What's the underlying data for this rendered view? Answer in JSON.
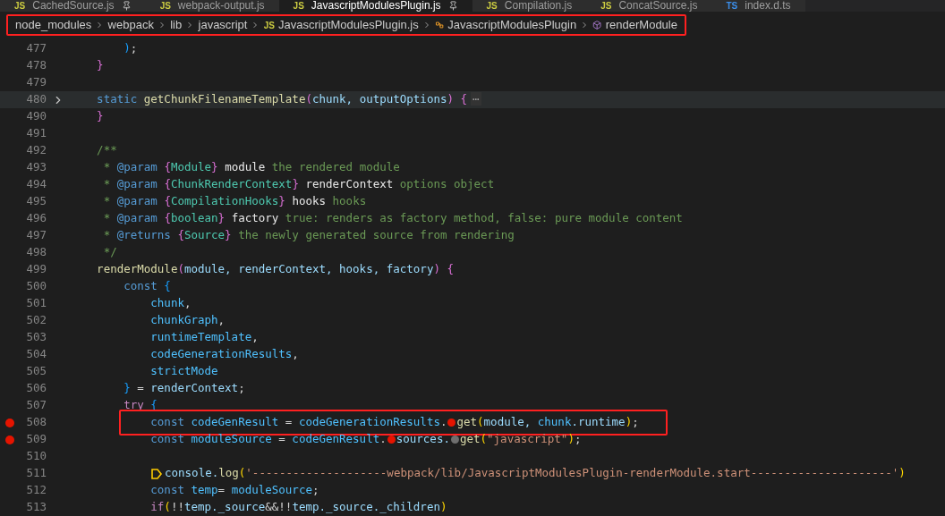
{
  "tabs": [
    {
      "icon": "JS",
      "label": "CachedSource.js",
      "pinned": true,
      "selected": false
    },
    {
      "icon": "JS",
      "label": "webpack-output.js",
      "pinned": false,
      "selected": false
    },
    {
      "icon": "JS",
      "label": "JavascriptModulesPlugin.js",
      "pinned": true,
      "selected": true
    },
    {
      "icon": "JS",
      "label": "Compilation.js",
      "pinned": false,
      "selected": false
    },
    {
      "icon": "JS",
      "label": "ConcatSource.js",
      "pinned": false,
      "selected": false
    },
    {
      "icon": "TS",
      "label": "index.d.ts",
      "pinned": false,
      "selected": false
    }
  ],
  "breadcrumb": {
    "annotated": true,
    "items": [
      {
        "kind": "folder",
        "label": "node_modules"
      },
      {
        "kind": "folder",
        "label": "webpack"
      },
      {
        "kind": "folder",
        "label": "lib"
      },
      {
        "kind": "folder",
        "label": "javascript"
      },
      {
        "kind": "file",
        "icon": "JS",
        "label": "JavascriptModulesPlugin.js"
      },
      {
        "kind": "class",
        "label": "JavascriptModulesPlugin"
      },
      {
        "kind": "method",
        "label": "renderModule"
      }
    ]
  },
  "lines": [
    {
      "number": "477",
      "breakpoint": false,
      "folded": false,
      "current": false,
      "annotated": false,
      "tokens": [
        {
          "kind": "bracket3",
          "text": "        )"
        },
        {
          "kind": "punct",
          "text": ";"
        }
      ]
    },
    {
      "number": "478",
      "breakpoint": false,
      "folded": false,
      "current": false,
      "annotated": false,
      "tokens": [
        {
          "kind": "bracket2",
          "text": "    }"
        }
      ]
    },
    {
      "number": "479",
      "breakpoint": false,
      "folded": false,
      "current": false,
      "annotated": false
    },
    {
      "number": "480",
      "breakpoint": false,
      "folded": true,
      "current": true,
      "annotated": false,
      "tokens": [
        {
          "kind": "keyword",
          "text": "    static "
        },
        {
          "kind": "function",
          "text": "getChunkFilenameTemplate"
        },
        {
          "kind": "bracket2",
          "text": "("
        },
        {
          "kind": "param",
          "text": "chunk, outputOptions"
        },
        {
          "kind": "bracket2",
          "text": ") {"
        },
        {
          "kind": "ellipsis",
          "text": "⋯"
        }
      ]
    },
    {
      "number": "490",
      "breakpoint": false,
      "folded": false,
      "current": false,
      "annotated": false,
      "tokens": [
        {
          "kind": "bracket2",
          "text": "    }"
        }
      ]
    },
    {
      "number": "491",
      "breakpoint": false,
      "folded": false,
      "current": false,
      "annotated": false
    },
    {
      "number": "492",
      "breakpoint": false,
      "folded": false,
      "current": false,
      "annotated": false,
      "tokens": [
        {
          "kind": "comment",
          "text": "    /**"
        }
      ]
    },
    {
      "number": "493",
      "breakpoint": false,
      "folded": false,
      "current": false,
      "annotated": false,
      "tokens": [
        {
          "kind": "comment",
          "text": "     * "
        },
        {
          "kind": "tag",
          "text": "@param "
        },
        {
          "kind": "bracket2",
          "text": "{"
        },
        {
          "kind": "type",
          "text": "Module"
        },
        {
          "kind": "bracket2",
          "text": "} "
        },
        {
          "kind": "docname",
          "text": "module"
        },
        {
          "kind": "comment",
          "text": " the rendered module"
        }
      ]
    },
    {
      "number": "494",
      "breakpoint": false,
      "folded": false,
      "current": false,
      "annotated": false,
      "tokens": [
        {
          "kind": "comment",
          "text": "     * "
        },
        {
          "kind": "tag",
          "text": "@param "
        },
        {
          "kind": "bracket2",
          "text": "{"
        },
        {
          "kind": "type",
          "text": "ChunkRenderContext"
        },
        {
          "kind": "bracket2",
          "text": "} "
        },
        {
          "kind": "docname",
          "text": "renderContext"
        },
        {
          "kind": "comment",
          "text": " options object"
        }
      ]
    },
    {
      "number": "495",
      "breakpoint": false,
      "folded": false,
      "current": false,
      "annotated": false,
      "tokens": [
        {
          "kind": "comment",
          "text": "     * "
        },
        {
          "kind": "tag",
          "text": "@param "
        },
        {
          "kind": "bracket2",
          "text": "{"
        },
        {
          "kind": "type",
          "text": "CompilationHooks"
        },
        {
          "kind": "bracket2",
          "text": "} "
        },
        {
          "kind": "docname",
          "text": "hooks"
        },
        {
          "kind": "comment",
          "text": " hooks"
        }
      ]
    },
    {
      "number": "496",
      "breakpoint": false,
      "folded": false,
      "current": false,
      "annotated": false,
      "tokens": [
        {
          "kind": "comment",
          "text": "     * "
        },
        {
          "kind": "tag",
          "text": "@param "
        },
        {
          "kind": "bracket2",
          "text": "{"
        },
        {
          "kind": "type",
          "text": "boolean"
        },
        {
          "kind": "bracket2",
          "text": "} "
        },
        {
          "kind": "docname",
          "text": "factory"
        },
        {
          "kind": "comment",
          "text": " true: renders as factory method, false: pure module content"
        }
      ]
    },
    {
      "number": "497",
      "breakpoint": false,
      "folded": false,
      "current": false,
      "annotated": false,
      "tokens": [
        {
          "kind": "comment",
          "text": "     * "
        },
        {
          "kind": "tag",
          "text": "@returns "
        },
        {
          "kind": "bracket2",
          "text": "{"
        },
        {
          "kind": "type",
          "text": "Source"
        },
        {
          "kind": "bracket2",
          "text": "}"
        },
        {
          "kind": "comment",
          "text": " the newly generated source from rendering"
        }
      ]
    },
    {
      "number": "498",
      "breakpoint": false,
      "folded": false,
      "current": false,
      "annotated": false,
      "tokens": [
        {
          "kind": "comment",
          "text": "     */"
        }
      ]
    },
    {
      "number": "499",
      "breakpoint": false,
      "folded": false,
      "current": false,
      "annotated": false,
      "tokens": [
        {
          "kind": "function",
          "text": "    renderModule"
        },
        {
          "kind": "bracket2",
          "text": "("
        },
        {
          "kind": "param",
          "text": "module, renderContext, hooks, factory"
        },
        {
          "kind": "bracket2",
          "text": ") {"
        }
      ]
    },
    {
      "number": "500",
      "breakpoint": false,
      "folded": false,
      "current": false,
      "annotated": false,
      "tokens": [
        {
          "kind": "keyword",
          "text": "        const "
        },
        {
          "kind": "bracket3",
          "text": "{"
        }
      ]
    },
    {
      "number": "501",
      "breakpoint": false,
      "folded": false,
      "current": false,
      "annotated": false,
      "tokens": [
        {
          "kind": "constant",
          "text": "            chunk"
        },
        {
          "kind": "punct",
          "text": ","
        }
      ]
    },
    {
      "number": "502",
      "breakpoint": false,
      "folded": false,
      "current": false,
      "annotated": false,
      "tokens": [
        {
          "kind": "constant",
          "text": "            chunkGraph"
        },
        {
          "kind": "punct",
          "text": ","
        }
      ]
    },
    {
      "number": "503",
      "breakpoint": false,
      "folded": false,
      "current": false,
      "annotated": false,
      "tokens": [
        {
          "kind": "constant",
          "text": "            runtimeTemplate"
        },
        {
          "kind": "punct",
          "text": ","
        }
      ]
    },
    {
      "number": "504",
      "breakpoint": false,
      "folded": false,
      "current": false,
      "annotated": false,
      "tokens": [
        {
          "kind": "constant",
          "text": "            codeGenerationResults"
        },
        {
          "kind": "punct",
          "text": ","
        }
      ]
    },
    {
      "number": "505",
      "breakpoint": false,
      "folded": false,
      "current": false,
      "annotated": false,
      "tokens": [
        {
          "kind": "constant",
          "text": "            strictMode"
        }
      ]
    },
    {
      "number": "506",
      "breakpoint": false,
      "folded": false,
      "current": false,
      "annotated": false,
      "tokens": [
        {
          "kind": "bracket3",
          "text": "        }"
        },
        {
          "kind": "punct",
          "text": " = "
        },
        {
          "kind": "param",
          "text": "renderContext"
        },
        {
          "kind": "punct",
          "text": ";"
        }
      ]
    },
    {
      "number": "507",
      "breakpoint": false,
      "folded": false,
      "current": false,
      "annotated": false,
      "tokens": [
        {
          "kind": "control",
          "text": "        try "
        },
        {
          "kind": "bracket3",
          "text": "{"
        }
      ]
    },
    {
      "number": "508",
      "breakpoint": true,
      "folded": false,
      "current": false,
      "annotated": true,
      "tokens": [
        {
          "kind": "keyword",
          "text": "            const "
        },
        {
          "kind": "constant",
          "text": "codeGenResult"
        },
        {
          "kind": "punct",
          "text": " = "
        },
        {
          "kind": "constant",
          "text": "codeGenerationResults"
        },
        {
          "kind": "punct",
          "text": "."
        },
        {
          "kind": "dot",
          "color": "#e51400"
        },
        {
          "kind": "function",
          "text": "get"
        },
        {
          "kind": "bracket1",
          "text": "("
        },
        {
          "kind": "param",
          "text": "module, "
        },
        {
          "kind": "constant",
          "text": "chunk"
        },
        {
          "kind": "param",
          "text": ".runtime"
        },
        {
          "kind": "bracket1",
          "text": ")"
        },
        {
          "kind": "punct",
          "text": ";"
        }
      ]
    },
    {
      "number": "509",
      "breakpoint": true,
      "folded": false,
      "current": false,
      "annotated": false,
      "tokens": [
        {
          "kind": "keyword",
          "text": "            const "
        },
        {
          "kind": "constant",
          "text": "moduleSource"
        },
        {
          "kind": "punct",
          "text": " = "
        },
        {
          "kind": "constant",
          "text": "codeGenResult"
        },
        {
          "kind": "punct",
          "text": "."
        },
        {
          "kind": "dot",
          "color": "#e51400"
        },
        {
          "kind": "param",
          "text": "sources."
        },
        {
          "kind": "dot",
          "color": "#6f6f6f"
        },
        {
          "kind": "function",
          "text": "get"
        },
        {
          "kind": "bracket1",
          "text": "("
        },
        {
          "kind": "string",
          "text": "\"javascript\""
        },
        {
          "kind": "bracket1",
          "text": ")"
        },
        {
          "kind": "punct",
          "text": ";"
        }
      ]
    },
    {
      "number": "510",
      "breakpoint": false,
      "folded": false,
      "current": false,
      "annotated": false
    },
    {
      "number": "511",
      "breakpoint": false,
      "folded": false,
      "current": false,
      "annotated": false,
      "tokens": [
        {
          "kind": "logpoint"
        },
        {
          "kind": "param",
          "text": "console."
        },
        {
          "kind": "function",
          "text": "log"
        },
        {
          "kind": "bracket1",
          "text": "("
        },
        {
          "kind": "string",
          "text": "'--------------------webpack/lib/JavascriptModulesPlugin-renderModule.start---------------------'"
        },
        {
          "kind": "bracket1",
          "text": ")"
        }
      ]
    },
    {
      "number": "512",
      "breakpoint": false,
      "folded": false,
      "current": false,
      "annotated": false,
      "tokens": [
        {
          "kind": "keyword",
          "text": "            const "
        },
        {
          "kind": "constant",
          "text": "temp"
        },
        {
          "kind": "punct",
          "text": "= "
        },
        {
          "kind": "constant",
          "text": "moduleSource"
        },
        {
          "kind": "punct",
          "text": ";"
        }
      ]
    },
    {
      "number": "513",
      "breakpoint": false,
      "folded": false,
      "current": false,
      "annotated": false,
      "tokens": [
        {
          "kind": "control",
          "text": "            if"
        },
        {
          "kind": "bracket1",
          "text": "("
        },
        {
          "kind": "punct",
          "text": "!!"
        },
        {
          "kind": "param",
          "text": "temp._source"
        },
        {
          "kind": "punct",
          "text": "&&!!"
        },
        {
          "kind": "param",
          "text": "temp._source._children"
        },
        {
          "kind": "bracket1",
          "text": ")"
        }
      ]
    }
  ]
}
